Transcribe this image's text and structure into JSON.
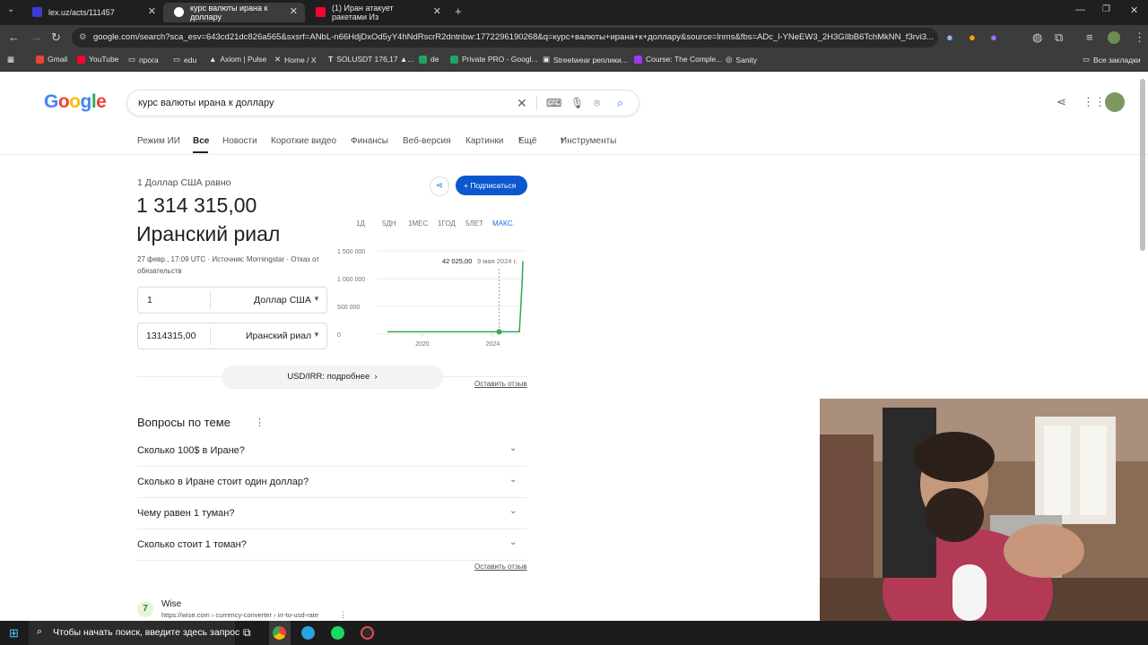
{
  "tabs": [
    {
      "title": "lex.uz/acts/111457",
      "favicon_color": "#3b3bd6"
    },
    {
      "title": "курс валюты ирана к доллару",
      "favicon_color": "#4285f4"
    },
    {
      "title": "(1) Иран атакует ракетами Из",
      "favicon_color": "#ff0033"
    }
  ],
  "url": "google.com/search?sca_esv=643cd21dc826a565&sxsrf=ANbL-n66HdjDxOd5yY4hNdRscrR2dntnbw:1772296190268&q=курс+валюты+ирана+к+доллару&source=lnms&fbs=ADc_l-YNeEW3_2H3GIlbB6TchMkNN_f3rvi3...",
  "bookmarks": [
    "Gmail",
    "YouTube",
    "прога",
    "edu",
    "Axiom | Pulse",
    "Home / X",
    "SOLUSDT 176,17 ▲...",
    "de",
    "Private PRO - Googl...",
    "Streetwear реплики...",
    "Course: The Comple...",
    "Sanity"
  ],
  "bookmarks_right": "Все закладки",
  "search": {
    "query": "курс валюты ирана к доллару"
  },
  "nav_tabs": [
    "Режим ИИ",
    "Все",
    "Новости",
    "Короткие видео",
    "Финансы",
    "Веб-версия",
    "Картинки",
    "Ещё",
    "Инструменты"
  ],
  "converter": {
    "equals_text": "1 Доллар США равно",
    "rate": "1 314 315,00",
    "currency_name": "Иранский риал",
    "meta": "27 февр., 17:09 UTC · Источник: Morningstar · Отказ от",
    "meta2": "обязательств",
    "from_value": "1",
    "from_currency": "Доллар США",
    "to_value": "1314315,00",
    "to_currency": "Иранский риал",
    "subscribe": "Подписаться",
    "more_button": "USD/IRR: подробнее",
    "feedback": "Оставить отзыв"
  },
  "range_buttons": [
    "1Д",
    "5ДН",
    "1МЕС",
    "1ГОД",
    "5ЛЕТ",
    "МАКС."
  ],
  "chart_data": {
    "type": "line",
    "series": [
      {
        "x": [
          2018,
          2019,
          2020,
          2021,
          2022,
          2023,
          2024.35,
          2024.9,
          2025.2,
          2025.5,
          2025.65,
          2025.7
        ],
        "values": [
          42000,
          42000,
          42000,
          42000,
          42000,
          42000,
          42025,
          42100,
          42100,
          42300,
          900000,
          1314315
        ]
      }
    ],
    "yticks": [
      "1 500 000",
      "1 000 000",
      "500 000",
      "0"
    ],
    "xticks": [
      "2020",
      "2024"
    ],
    "ylim": [
      0,
      1500000
    ],
    "tooltip_value": "42 025,00",
    "tooltip_date": "9 мая 2024 г.",
    "color": "#34a853"
  },
  "faq": {
    "title": "Вопросы по теме",
    "items": [
      "Сколько 100$ в Иране?",
      "Сколько в Иране стоит один доллар?",
      "Чему равен 1 туман?",
      "Сколько стоит 1 томан?"
    ],
    "feedback": "Оставить отзыв"
  },
  "result": {
    "site": "Wise",
    "url": "https://wise.com › currency-converter › irr-to-usd-rate"
  },
  "taskbar": {
    "search_placeholder": "Чтобы начать поиск, введите здесь запрос"
  }
}
